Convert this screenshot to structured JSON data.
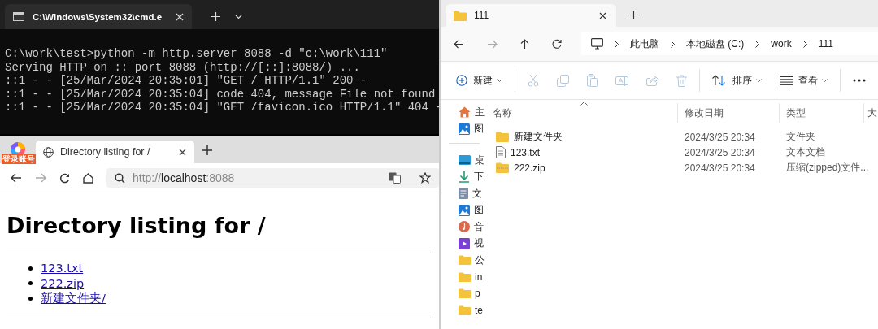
{
  "terminal": {
    "tab": {
      "title": "C:\\Windows\\System32\\cmd.e"
    },
    "lines": [
      "C:\\work\\test>python -m http.server 8088 -d \"c:\\work\\111\"",
      "Serving HTTP on :: port 8088 (http://[::]:8088/) ...",
      "::1 - - [25/Mar/2024 20:35:01] \"GET / HTTP/1.1\" 200 -",
      "::1 - - [25/Mar/2024 20:35:04] code 404, message File not found",
      "::1 - - [25/Mar/2024 20:35:04] \"GET /favicon.ico HTTP/1.1\" 404 -"
    ]
  },
  "browser": {
    "login_badge": "登录账号",
    "tab": {
      "title": "Directory listing for /"
    },
    "url": {
      "scheme": "http://",
      "host": "localhost",
      "port": ":8088"
    },
    "page": {
      "heading": "Directory listing for /",
      "links": [
        "123.txt",
        "222.zip",
        "新建文件夹/"
      ]
    }
  },
  "explorer": {
    "tab": {
      "title": "111"
    },
    "breadcrumb": [
      "此电脑",
      "本地磁盘 (C:)",
      "work",
      "111"
    ],
    "toolbar": [
      {
        "kind": "new",
        "label": "新建",
        "dropdown": true,
        "disabled": false
      },
      {
        "kind": "cut",
        "dropdown": false,
        "disabled": true
      },
      {
        "kind": "copy",
        "dropdown": false,
        "disabled": true
      },
      {
        "kind": "paste",
        "dropdown": false,
        "disabled": true
      },
      {
        "kind": "rename",
        "dropdown": false,
        "disabled": true
      },
      {
        "kind": "share",
        "dropdown": false,
        "disabled": true
      },
      {
        "kind": "delete",
        "dropdown": false,
        "disabled": true
      },
      {
        "kind": "sort",
        "label": "排序",
        "dropdown": true,
        "disabled": false
      },
      {
        "kind": "view",
        "label": "查看",
        "dropdown": true,
        "disabled": false
      },
      {
        "kind": "more",
        "dropdown": false,
        "disabled": false
      }
    ],
    "sidebar": [
      {
        "items": [
          {
            "kind": "home",
            "label": "主"
          },
          {
            "kind": "gallery",
            "label": "图"
          }
        ]
      },
      {
        "items": [
          {
            "kind": "desktop",
            "label": "桌"
          },
          {
            "kind": "download",
            "label": "下"
          },
          {
            "kind": "document",
            "label": "文"
          },
          {
            "kind": "picture",
            "label": "图"
          },
          {
            "kind": "music",
            "label": "音"
          },
          {
            "kind": "video",
            "label": "视"
          },
          {
            "kind": "folder",
            "label": "公"
          },
          {
            "kind": "folder",
            "label": "in"
          },
          {
            "kind": "folder",
            "label": "p"
          },
          {
            "kind": "folder",
            "label": "te"
          }
        ]
      }
    ],
    "columns": [
      "名称",
      "修改日期",
      "类型",
      "大"
    ],
    "files": [
      {
        "kind": "folder",
        "name": "新建文件夹",
        "modified": "2024/3/25 20:34",
        "type": "文件夹"
      },
      {
        "kind": "text",
        "name": "123.txt",
        "modified": "2024/3/25 20:34",
        "type": "文本文档"
      },
      {
        "kind": "zip",
        "name": "222.zip",
        "modified": "2024/3/25 20:34",
        "type": "压缩(zipped)文件..."
      }
    ]
  }
}
